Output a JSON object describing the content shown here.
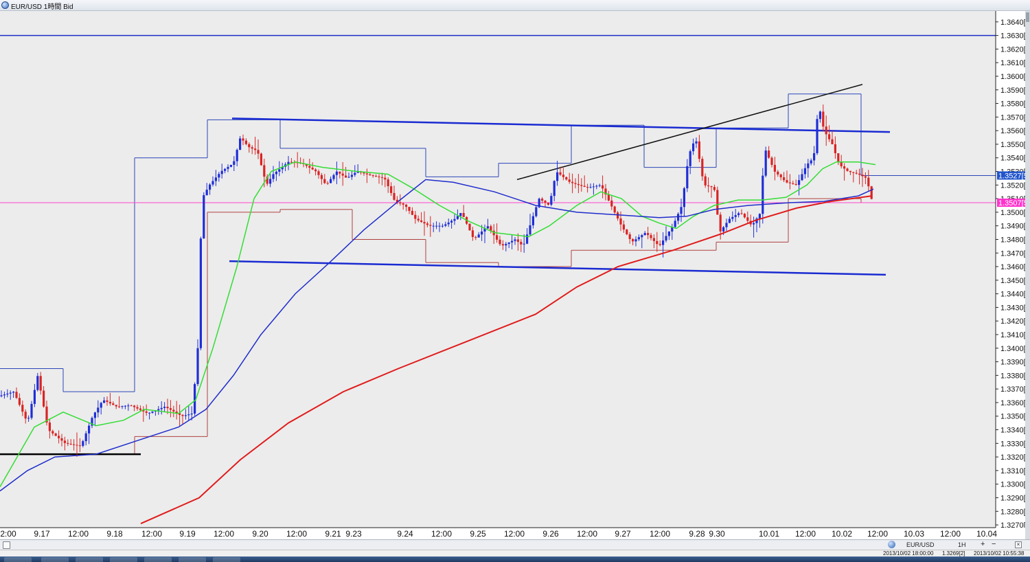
{
  "window": {
    "title": "EUR/USD 1時間 Bid"
  },
  "chart_data": {
    "type": "candlestick",
    "symbol": "EUR/USD",
    "timeframe": "1時間",
    "price_type": "Bid",
    "y_ticks": [
      "1.3640[0",
      "1.3630[0",
      "1.3620[0",
      "1.3610[0",
      "1.3600[0",
      "1.3590[0",
      "1.3580[0",
      "1.3570[0",
      "1.3560[0",
      "1.3550[0",
      "1.3540[0",
      "1.3530[0",
      "1.3520[0",
      "1.3510[0",
      "1.3500[0",
      "1.3490[0",
      "1.3480[0",
      "1.3470[0",
      "1.3460[0",
      "1.3450[0",
      "1.3440[0",
      "1.3430[0",
      "1.3420[0",
      "1.3410[0",
      "1.3400[0",
      "1.3390[0",
      "1.3380[0",
      "1.3370[0",
      "1.3360[0",
      "1.3350[0",
      "1.3340[0",
      "1.3330[0",
      "1.3320[0",
      "1.3310[0",
      "1.3300[0",
      "1.3290[0",
      "1.3280[0",
      "1.3270[0"
    ],
    "ylim": [
      1.3268,
      1.3648
    ],
    "x_ticks": [
      "2:00",
      "9.17",
      "12:00",
      "9.18",
      "12:00",
      "9.19",
      "12:00",
      "9.20",
      "12:00",
      "9.21",
      "9.23",
      "9.24",
      "12:00",
      "9.25",
      "12:00",
      "9.26",
      "12:00",
      "9.27",
      "12:00",
      "9.28",
      "9.30",
      "10.01",
      "12:00",
      "10.02",
      "12:00",
      "10.03",
      "12:00",
      "10.04"
    ],
    "price_labels": {
      "ask": "1.3527[5",
      "bid": "1.3507[5"
    },
    "horizontal_levels": [
      1.363,
      1.3507
    ],
    "colors": {
      "up_candle": "#1e2ed6",
      "down_candle": "#d92424",
      "ma_short": "#33dd33",
      "ma_mid": "#1f2ccc",
      "ma_long": "#e01c1c",
      "trendline": "#1a2bd1",
      "high_box": "#2b44b8",
      "low_box": "#b04040",
      "bid_line": "#ff44cc",
      "level_line": "#1a2ec4",
      "support_line": "#000000"
    }
  },
  "bottom_bar": {
    "symbol": "EUR/USD",
    "timeframe": "1H",
    "plus": "+",
    "minus": "−",
    "close": "×"
  },
  "status_bar": {
    "left": "2013/10/02 18:00:00",
    "mid": "1.3269[2]",
    "right": "2013/10/02 10:55:38"
  }
}
